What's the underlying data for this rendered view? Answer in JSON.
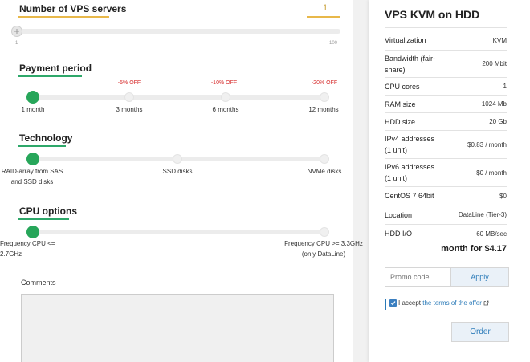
{
  "vps_count": {
    "title": "Number of VPS servers",
    "value": "1",
    "min_label": "1",
    "max_label": "100"
  },
  "payment": {
    "title": "Payment period",
    "options": [
      {
        "label": "1 month",
        "discount": ""
      },
      {
        "label": "3 months",
        "discount": "-5% OFF"
      },
      {
        "label": "6 months",
        "discount": "-10% OFF"
      },
      {
        "label": "12 months",
        "discount": "-20% OFF"
      }
    ]
  },
  "technology": {
    "title": "Technology",
    "options": [
      {
        "line1": "RAID-array from SAS",
        "line2": "and SSD disks"
      },
      {
        "line1": "SSD disks",
        "line2": ""
      },
      {
        "line1": "NVMe disks",
        "line2": ""
      }
    ]
  },
  "cpu": {
    "title": "CPU options",
    "options": [
      {
        "line1": "Frequency CPU <= 2.7GHz",
        "line2": ""
      },
      {
        "line1": "Frequency CPU >= 3.3GHz",
        "line2": "(only DataLine)"
      }
    ]
  },
  "comments": {
    "label": "Comments"
  },
  "summary": {
    "title": "VPS KVM on HDD",
    "specs": [
      {
        "label": "Virtualization",
        "value": "KVM"
      },
      {
        "label": "Bandwidth (fair-share)",
        "value": "200 Mbit"
      },
      {
        "label": "CPU cores",
        "value": "1"
      },
      {
        "label": "RAM size",
        "value": "1024 Mb"
      },
      {
        "label": "HDD size",
        "value": "20 Gb"
      },
      {
        "label": "IPv4 addresses (1 unit)",
        "value": "$0.83 / month"
      },
      {
        "label": "IPv6 addresses (1 unit)",
        "value": "$0 / month"
      },
      {
        "label": "CentOS 7 64bit",
        "value": "$0"
      },
      {
        "label": "Location",
        "value": "DataLine (Tier-3)"
      },
      {
        "label": "HDD I/O",
        "value": "60 MB/sec"
      }
    ],
    "price": "month for $4.17",
    "promo_placeholder": "Promo code",
    "apply_label": "Apply",
    "accept_text": "I accept",
    "terms_link": "the terms of the offer",
    "order_label": "Order"
  },
  "colors": {
    "accent_green": "#27a65a",
    "accent_orange": "#e8b84a",
    "link_blue": "#2a7ab8"
  }
}
